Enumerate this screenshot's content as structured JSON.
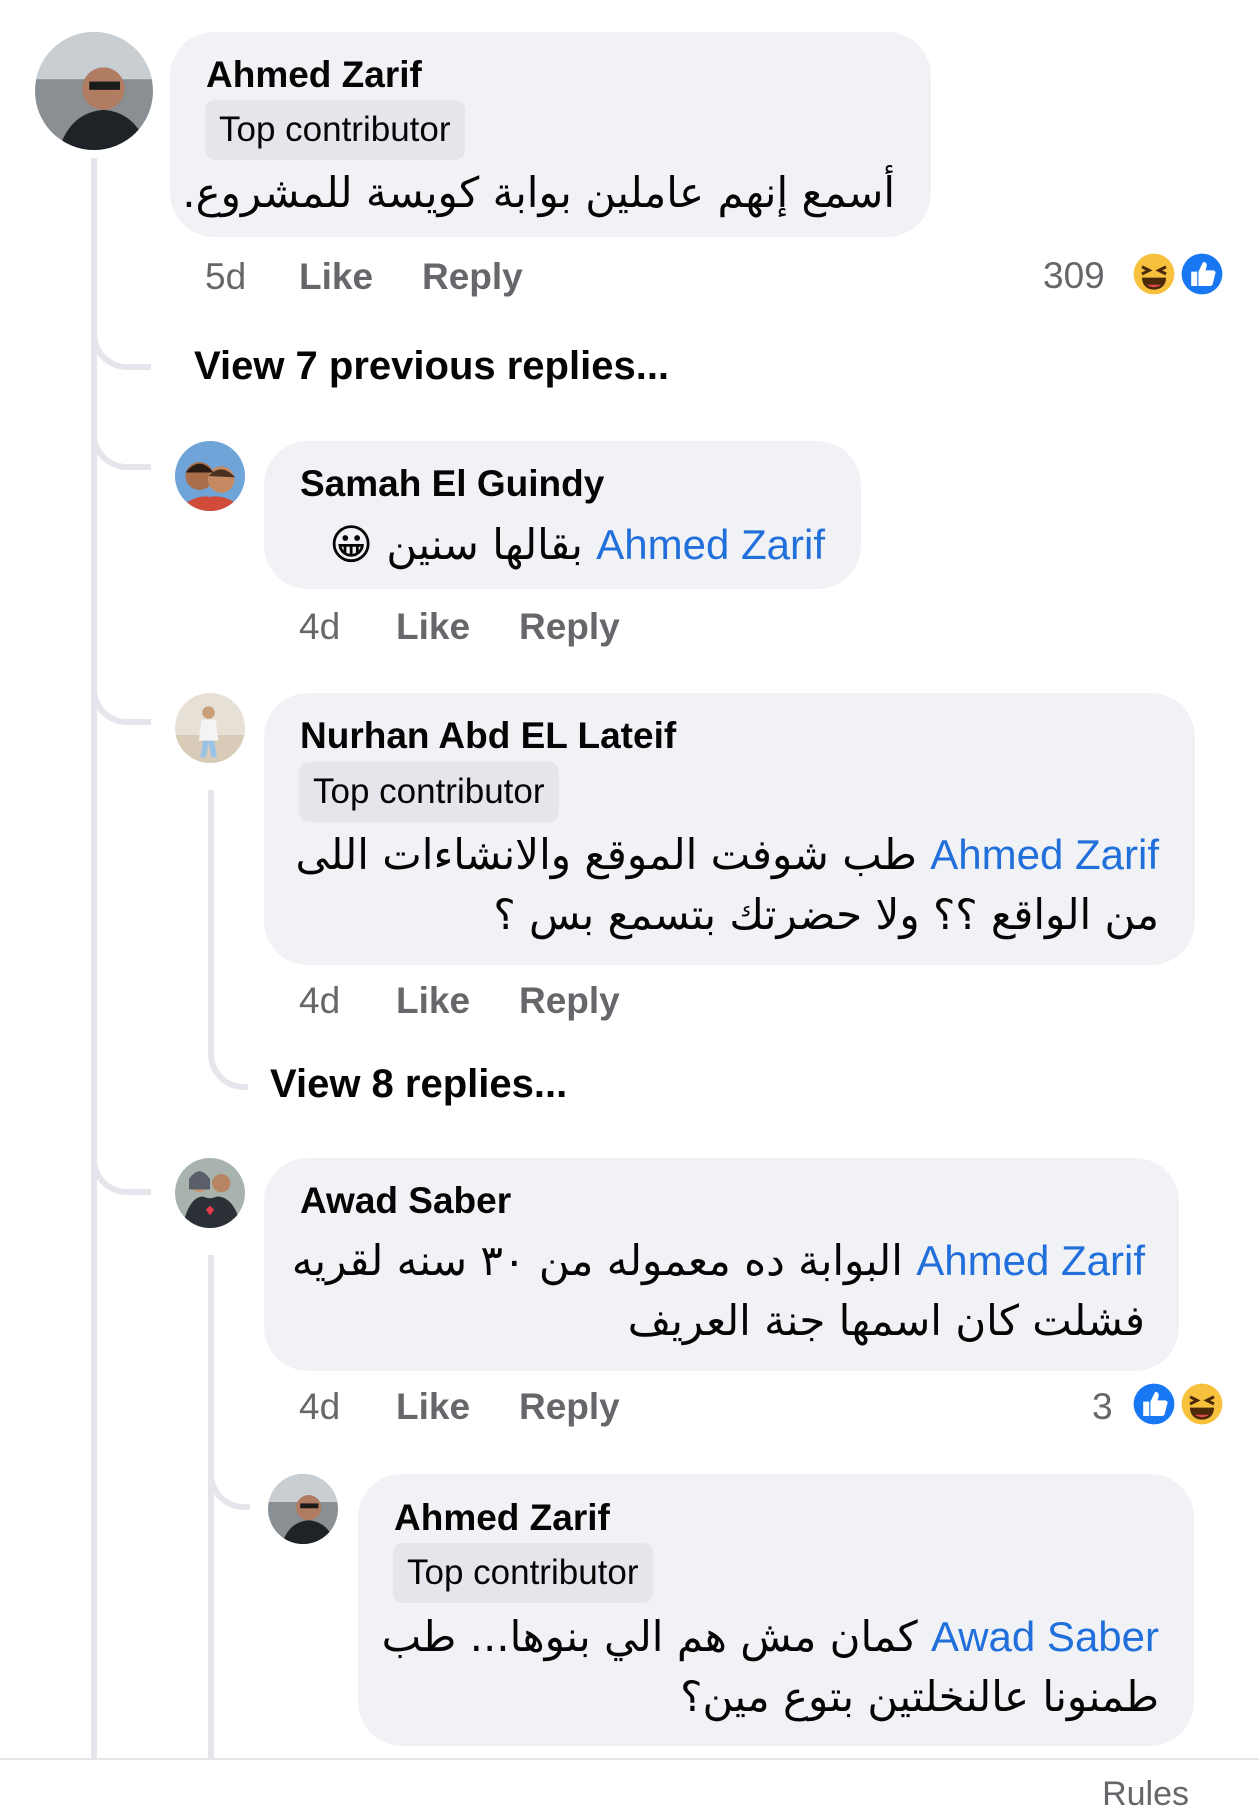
{
  "comment": {
    "author": "Ahmed Zarif",
    "badge": "Top contributor",
    "text": "أسمع إنهم عاملين بوابة كويسة للمشروع.",
    "time": "5d",
    "like_label": "Like",
    "reply_label": "Reply",
    "reaction_count": "309",
    "reactions": [
      "haha-icon",
      "like-icon"
    ]
  },
  "view_previous": "View 7 previous replies...",
  "replies": [
    {
      "author": "Samah El Guindy",
      "mention": "Ahmed Zarif",
      "text": "بقالها سنين",
      "emoji": "😀",
      "time": "4d",
      "like_label": "Like",
      "reply_label": "Reply"
    },
    {
      "author": "Nurhan Abd EL Lateif",
      "badge": "Top contributor",
      "mention": "Ahmed Zarif",
      "line1": "طب شوفت الموقع والانشاءات اللى",
      "line2": "من الواقع ؟؟ ولا حضرتك بتسمع بس ؟",
      "time": "4d",
      "like_label": "Like",
      "reply_label": "Reply",
      "view_replies": "View 8 replies..."
    },
    {
      "author": "Awad Saber",
      "mention": "Ahmed Zarif",
      "line1": "البوابة ده معموله من ٣٠ سنه لقريه",
      "line2": "فشلت كان اسمها جنة العريف",
      "time": "4d",
      "like_label": "Like",
      "reply_label": "Reply",
      "reaction_count": "3",
      "reactions": [
        "like-icon",
        "haha-icon"
      ]
    }
  ],
  "nested_reply": {
    "author": "Ahmed Zarif",
    "badge": "Top contributor",
    "mention": "Awad Saber",
    "line1": "كمان مش هم الي بنوها... طب",
    "line2": "طمنونا عالنخلتين بتوع مين؟"
  },
  "bottom_text": "Rules",
  "colors": {
    "bubble": "#f0f2f5",
    "mention": "#216fdb",
    "meta": "#65676b",
    "like_blue": "#1877f2",
    "haha_yellow": "#f7c13d"
  }
}
